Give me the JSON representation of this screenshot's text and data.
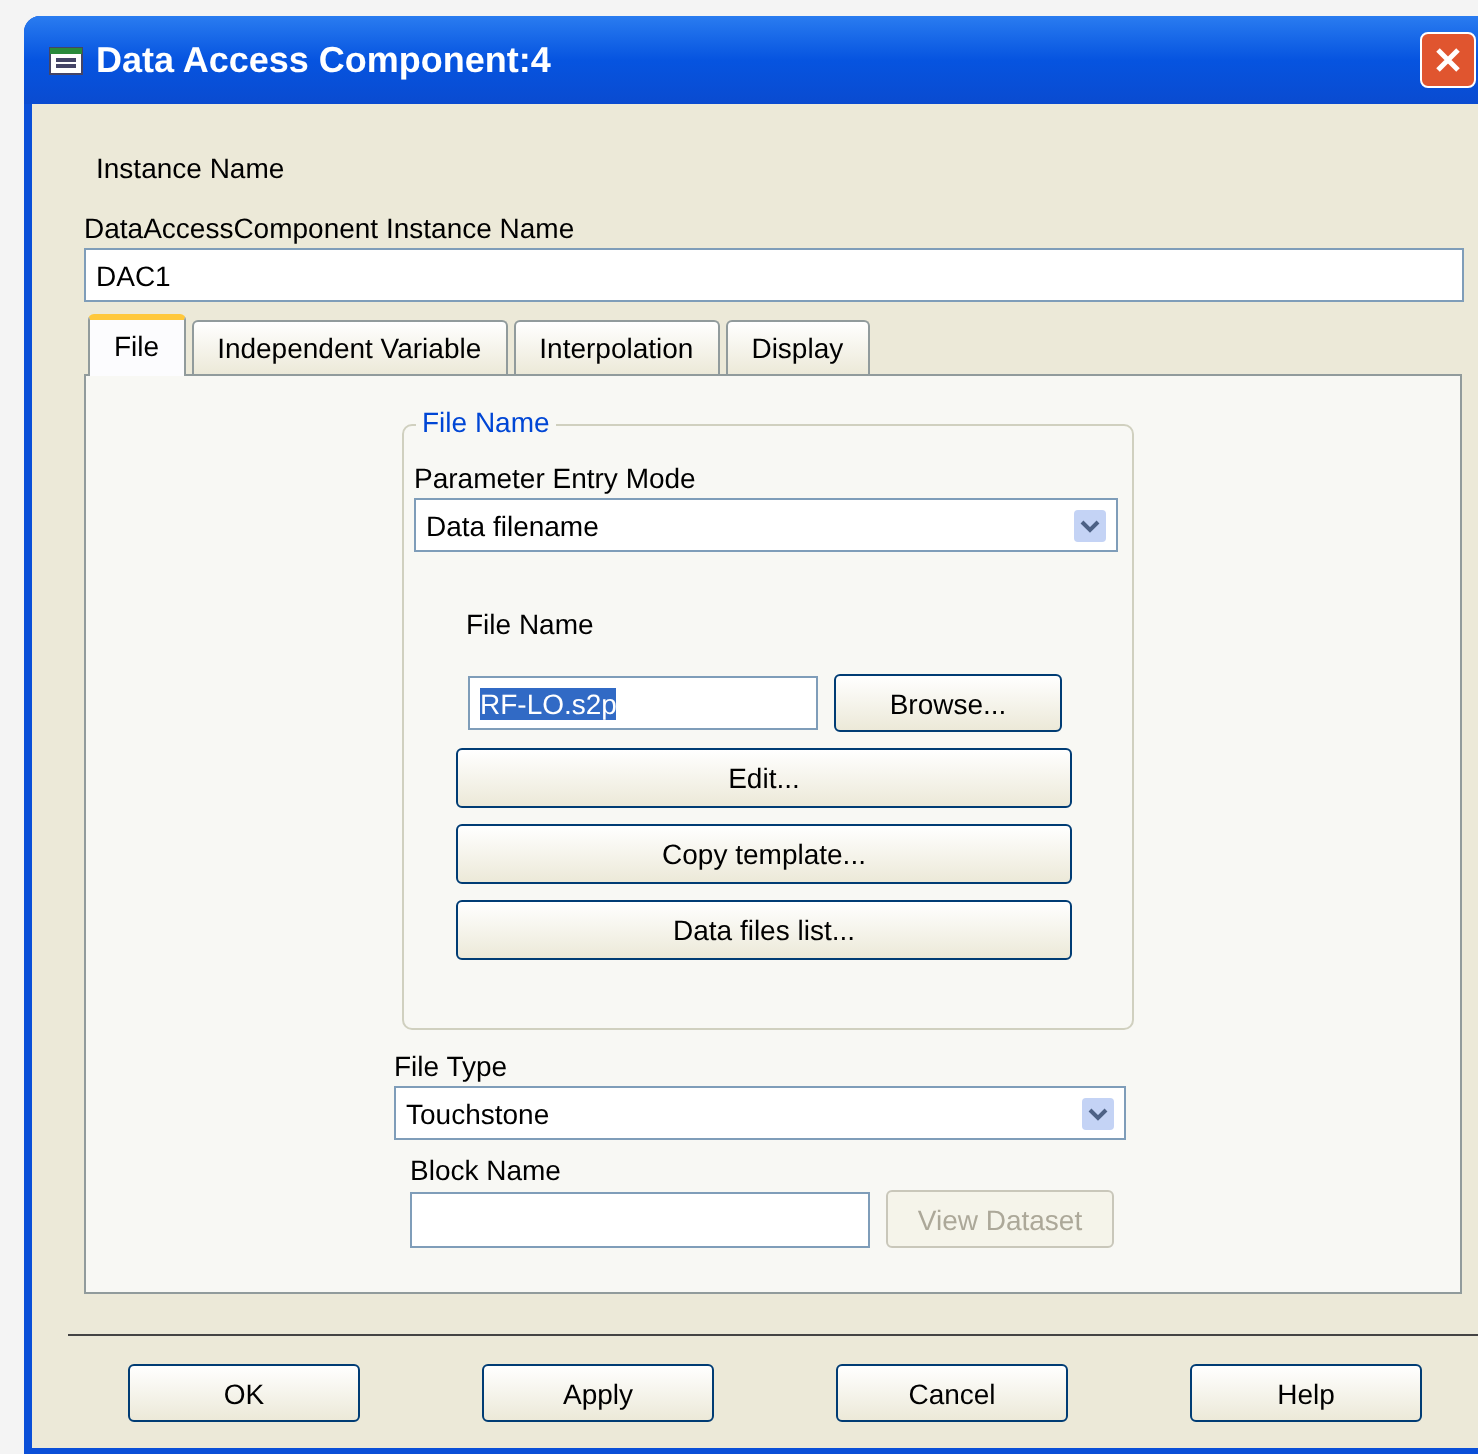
{
  "window": {
    "title": "Data Access Component:4"
  },
  "instance": {
    "heading": "Instance Name",
    "label": "DataAccessComponent Instance Name",
    "value": "DAC1"
  },
  "tabs": [
    {
      "label": "File",
      "selected": true
    },
    {
      "label": "Independent Variable",
      "selected": false
    },
    {
      "label": "Interpolation",
      "selected": false
    },
    {
      "label": "Display",
      "selected": false
    }
  ],
  "file_group": {
    "title": "File Name",
    "mode_label": "Parameter Entry Mode",
    "mode_value": "Data filename",
    "file_label": "File Name",
    "file_value": "RF-LO.s2p",
    "browse": "Browse...",
    "buttons": [
      {
        "label": "Edit...",
        "disabled": false
      },
      {
        "label": "Copy template...",
        "disabled": false
      },
      {
        "label": "Data files list...",
        "disabled": false
      }
    ]
  },
  "file_type": {
    "label": "File Type",
    "value": "Touchstone"
  },
  "block": {
    "label": "Block Name",
    "button": "View Dataset",
    "button_disabled": true
  },
  "buttons": [
    "OK",
    "Apply",
    "Cancel",
    "Help"
  ]
}
